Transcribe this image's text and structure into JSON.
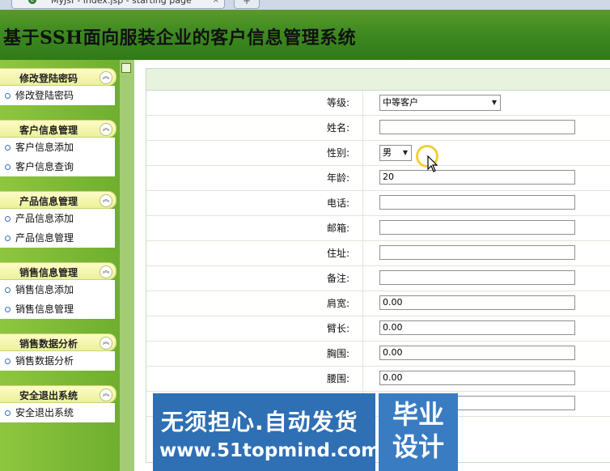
{
  "browser": {
    "tab_title": "MyJsf - index.jsp - starting page",
    "tab_close": "×",
    "new_tab": "+"
  },
  "header": {
    "title": "基于SSH面向服装企业的客户信息管理系统"
  },
  "sidebar": {
    "groups": [
      {
        "title": "修改登陆密码",
        "items": [
          "修改登陆密码"
        ]
      },
      {
        "title": "客户信息管理",
        "items": [
          "客户信息添加",
          "客户信息查询"
        ]
      },
      {
        "title": "产品信息管理",
        "items": [
          "产品信息添加",
          "产品信息管理"
        ]
      },
      {
        "title": "销售信息管理",
        "items": [
          "销售信息添加",
          "销售信息管理"
        ]
      },
      {
        "title": "销售数据分析",
        "items": [
          "销售数据分析"
        ]
      },
      {
        "title": "安全退出系统",
        "items": [
          "安全退出系统"
        ]
      }
    ]
  },
  "form": {
    "fields": [
      {
        "label": "等级:",
        "type": "select",
        "value": "中等客户"
      },
      {
        "label": "姓名:",
        "type": "text",
        "value": ""
      },
      {
        "label": "性别:",
        "type": "select",
        "value": "男"
      },
      {
        "label": "年龄:",
        "type": "text",
        "value": "20"
      },
      {
        "label": "电话:",
        "type": "text",
        "value": ""
      },
      {
        "label": "邮箱:",
        "type": "text",
        "value": ""
      },
      {
        "label": "住址:",
        "type": "text",
        "value": ""
      },
      {
        "label": "备注:",
        "type": "text",
        "value": ""
      },
      {
        "label": "肩宽:",
        "type": "text",
        "value": "0.00"
      },
      {
        "label": "臂长:",
        "type": "text",
        "value": "0.00"
      },
      {
        "label": "胸围:",
        "type": "text",
        "value": "0.00"
      },
      {
        "label": "腰围:",
        "type": "text",
        "value": "0.00"
      },
      {
        "label": "",
        "type": "text",
        "value": ""
      }
    ]
  },
  "watermark": {
    "line1": "无须担心.自动发货",
    "line2": "www.51topmind.com",
    "side": "毕业设计"
  },
  "colors": {
    "header_green": "#3f8a22",
    "sidebar_green": "#8ec63f",
    "menu_head": "#eaf19a",
    "watermark_blue": "#2f6fb3"
  }
}
